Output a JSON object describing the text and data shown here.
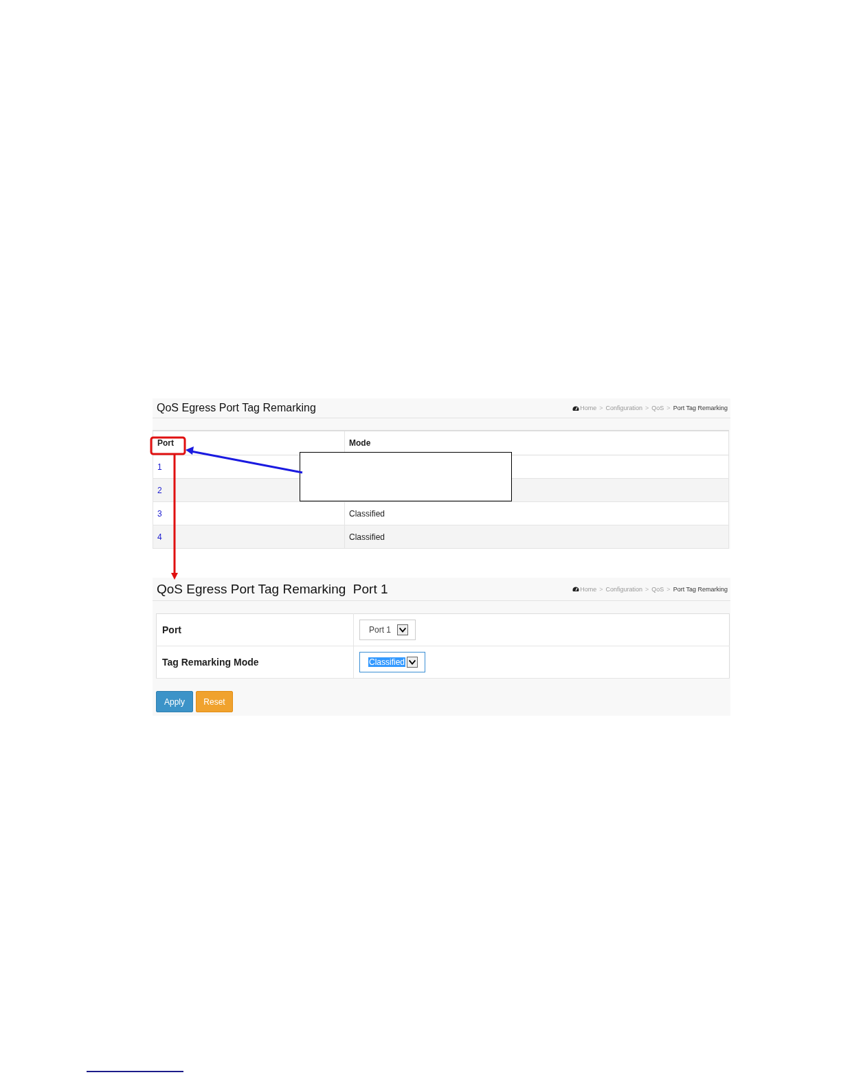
{
  "list_view": {
    "title": "QoS Egress Port Tag Remarking",
    "breadcrumb": {
      "separator": ">",
      "items": [
        {
          "label": "Home",
          "current": false
        },
        {
          "label": "Configuration",
          "current": false
        },
        {
          "label": "QoS",
          "current": false
        },
        {
          "label": "Port Tag Remarking",
          "current": true
        }
      ]
    },
    "columns": [
      "Port",
      "Mode"
    ],
    "rows": [
      {
        "port": "1"
      },
      {
        "port": "2"
      },
      {
        "port": "3",
        "mode": "Classified"
      },
      {
        "port": "4",
        "mode": "Classified"
      }
    ]
  },
  "detail_view": {
    "title": "QoS Egress Port Tag Remarking  Port 1",
    "breadcrumb": {
      "separator": ">",
      "items": [
        {
          "label": "Home",
          "current": false
        },
        {
          "label": "Configuration",
          "current": false
        },
        {
          "label": "QoS",
          "current": false
        },
        {
          "label": "Port Tag Remarking",
          "current": true
        }
      ]
    },
    "fields": [
      {
        "label": "Port",
        "value": "Port 1",
        "highlighted": false
      },
      {
        "label": "Tag Remarking Mode",
        "value": "Classified",
        "highlighted": true
      }
    ],
    "buttons": [
      {
        "label": "Apply",
        "kind": "primary"
      },
      {
        "label": "Reset",
        "kind": "warning"
      }
    ]
  }
}
